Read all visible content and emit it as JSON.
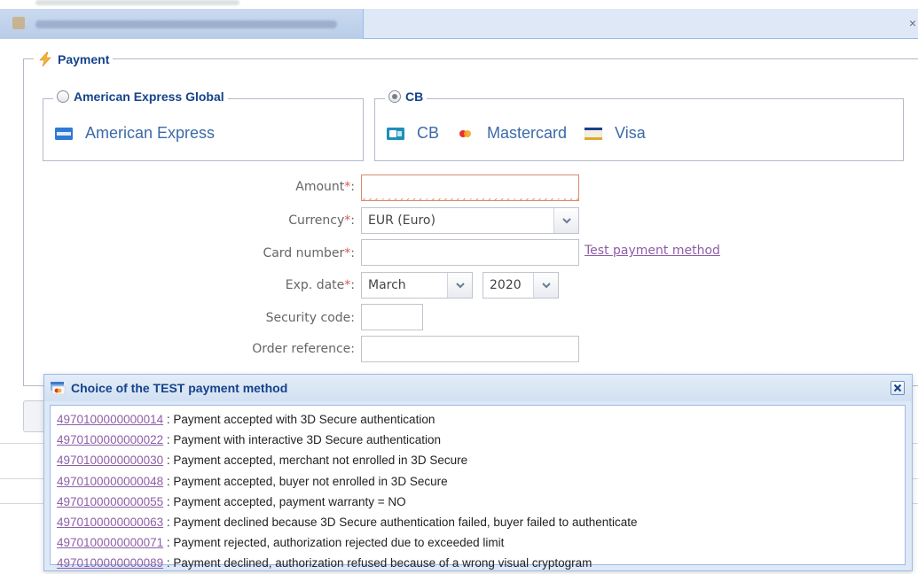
{
  "window": {
    "close_glyph": "×"
  },
  "payment": {
    "legend": "Payment",
    "groups": {
      "amex": {
        "legend": "American Express Global",
        "brands": [
          {
            "label": "American Express",
            "icon": "amex-card-icon"
          }
        ]
      },
      "cb": {
        "legend": "CB",
        "brands": [
          {
            "label": "CB",
            "icon": "cb-card-icon"
          },
          {
            "label": "Mastercard",
            "icon": "mastercard-icon"
          },
          {
            "label": "Visa",
            "icon": "visa-card-icon"
          }
        ]
      }
    }
  },
  "form": {
    "amount": {
      "label": "Amount",
      "required": "*",
      "colon": ":",
      "value": ""
    },
    "currency": {
      "label": "Currency",
      "required": "*",
      "colon": ":",
      "value": "EUR (Euro)"
    },
    "card_number": {
      "label": "Card number",
      "required": "*",
      "colon": ":",
      "value": ""
    },
    "test_link": "Test payment method",
    "exp_date": {
      "label": "Exp. date",
      "required": "*",
      "colon": ":",
      "month": "March",
      "year": "2020"
    },
    "security_code": {
      "label": "Security code:",
      "value": ""
    },
    "order_reference": {
      "label": "Order reference:",
      "value": ""
    }
  },
  "test_popup": {
    "title": "Choice of the TEST payment method",
    "separator": " : ",
    "rows": [
      {
        "card": "4970100000000014",
        "desc": "Payment accepted with 3D Secure authentication"
      },
      {
        "card": "4970100000000022",
        "desc": "Payment with interactive 3D Secure authentication"
      },
      {
        "card": "4970100000000030",
        "desc": "Payment accepted, merchant not enrolled in 3D Secure"
      },
      {
        "card": "4970100000000048",
        "desc": "Payment accepted, buyer not enrolled in 3D Secure"
      },
      {
        "card": "4970100000000055",
        "desc": "Payment accepted, payment warranty = NO"
      },
      {
        "card": "4970100000000063",
        "desc": "Payment declined because 3D Secure authentication failed, buyer failed to authenticate"
      },
      {
        "card": "4970100000000071",
        "desc": "Payment rejected, authorization rejected due to exceeded limit"
      },
      {
        "card": "4970100000000089",
        "desc": "Payment declined, authorization refused because of a wrong visual cryptogram"
      }
    ]
  },
  "colors": {
    "accent": "#15428b",
    "link": "#8e5ea8",
    "required": "#e05555",
    "brand_text": "#3b6aa8"
  }
}
